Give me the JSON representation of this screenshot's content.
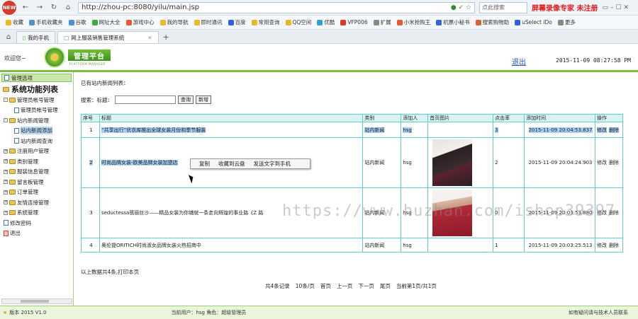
{
  "browser": {
    "new_badge": "NEW",
    "url": "http://zhou-pc:8080/yilu/main.jsp",
    "search_placeholder": "点此搜索",
    "watermark": "屏幕录像专家 未注册",
    "bookmarks": [
      {
        "label": "收藏",
        "color": "#f0b429"
      },
      {
        "label": "手机收藏夹",
        "color": "#4a90d9"
      },
      {
        "label": "谷歌",
        "color": "#4a90d9"
      },
      {
        "label": "网址大全",
        "color": "#3bab3b"
      },
      {
        "label": "游戏中心",
        "color": "#e35d2f"
      },
      {
        "label": "我的导航",
        "color": "#f0b429"
      },
      {
        "label": "即时通讯",
        "color": "#f0b429"
      },
      {
        "label": "百度",
        "color": "#2a66d8"
      },
      {
        "label": "常用查询",
        "color": "#f0b429"
      },
      {
        "label": "QQ空间",
        "color": "#f0b429"
      },
      {
        "label": "优酷",
        "color": "#2aa0e0"
      },
      {
        "label": "VFP006",
        "color": "#d63a2a"
      },
      {
        "label": "扩展",
        "color": "#888888"
      },
      {
        "label": "小米抢购王",
        "color": "#e35d2f"
      },
      {
        "label": "机票小秘书",
        "color": "#2a66d8"
      },
      {
        "label": "搜索购物助",
        "color": "#e35d2f"
      },
      {
        "label": "uSelect iDo",
        "color": "#2a66d8"
      },
      {
        "label": "更多",
        "color": "#888888"
      }
    ],
    "tabs": [
      {
        "label": "我的手机"
      },
      {
        "label": "网上服装销售管理系统"
      }
    ]
  },
  "header": {
    "welcome": "欢迎您~",
    "logo_text": "管理平台",
    "logo_sub": "PLATFORM MANAGER",
    "logout": "退出",
    "clock": "2015-11-09 08:27:58 PM"
  },
  "sidebar": {
    "head": "管理选项",
    "title": "系统功能列表",
    "items": [
      {
        "label": "管理员帐号管理",
        "level": 1
      },
      {
        "label": "管理员帐号管理",
        "level": 2
      },
      {
        "label": "站内新闻管理",
        "level": 1
      },
      {
        "label": "站内新闻添加",
        "level": 2
      },
      {
        "label": "站内新闻查询",
        "level": 2
      },
      {
        "label": "注册用户管理",
        "level": 1
      },
      {
        "label": "类别管理",
        "level": 1
      },
      {
        "label": "服装信息管理",
        "level": 1
      },
      {
        "label": "留言板管理",
        "level": 1
      },
      {
        "label": "订单管理",
        "level": 1
      },
      {
        "label": "友情连接管理",
        "level": 1
      },
      {
        "label": "系统管理",
        "level": 1
      },
      {
        "label": "修改密码",
        "level": 1
      },
      {
        "label": "退出",
        "level": 1
      }
    ]
  },
  "main": {
    "crumb": "已有站内新闻列表：",
    "search_label": "搜索：标题：",
    "search_btn": "查询",
    "add_btn": "新增",
    "columns": [
      "序号",
      "标题",
      "类别",
      "添加人",
      "首页图片",
      "点击率",
      "添加时间",
      "操作"
    ],
    "rows": [
      {
        "no": "1",
        "title": "“共享出行”优衣库推出全球女装月份和季节服装",
        "category": "站内新闻",
        "adder": "hsg",
        "click": "3",
        "time": "2015-11-09 20:04:53.837",
        "ops": [
          "修改",
          "删除"
        ]
      },
      {
        "no": "2",
        "title": "时尚品牌女装-欧美品牌女装加盟店",
        "category": "站内新闻",
        "adder": "hsg",
        "click": "2",
        "time": "2015-11-09 20:04:24.903",
        "ops": [
          "修改",
          "删除"
        ]
      },
      {
        "no": "3",
        "title": "seductessa翡丽丝沙——精品女装为你铺就一条走向辉煌的事业路《Z 路",
        "category": "站内新闻",
        "adder": "hsg",
        "click": "0",
        "time": "2015-11-09 20:03:53.880",
        "ops": [
          "修改",
          "删除"
        ]
      },
      {
        "no": "4",
        "title": "奥伦提ORITICH时尚淑女品牌女装火热招商中",
        "category": "站内新闻",
        "adder": "hsg",
        "click": "1",
        "time": "2015-11-09 20:03:25.513",
        "ops": [
          "修改",
          "删除"
        ]
      }
    ],
    "context_menu": [
      "复制",
      "收藏到云盘",
      "发送文字到手机"
    ],
    "footnote": "以上数据共4条,打印本页",
    "pager": [
      "共4条记录",
      "10条/页",
      "首页",
      "上一页",
      "下一页",
      "尾页",
      "当前第1页/共1页"
    ],
    "overlay_watermark": "https://www.huzhan.com/ishop39397"
  },
  "status": {
    "copyright": "版本 2015 V1.0",
    "current_user": "当前用户：hsg  角色：超级管理员",
    "contact": "如有疑问请与技术人员联系"
  }
}
